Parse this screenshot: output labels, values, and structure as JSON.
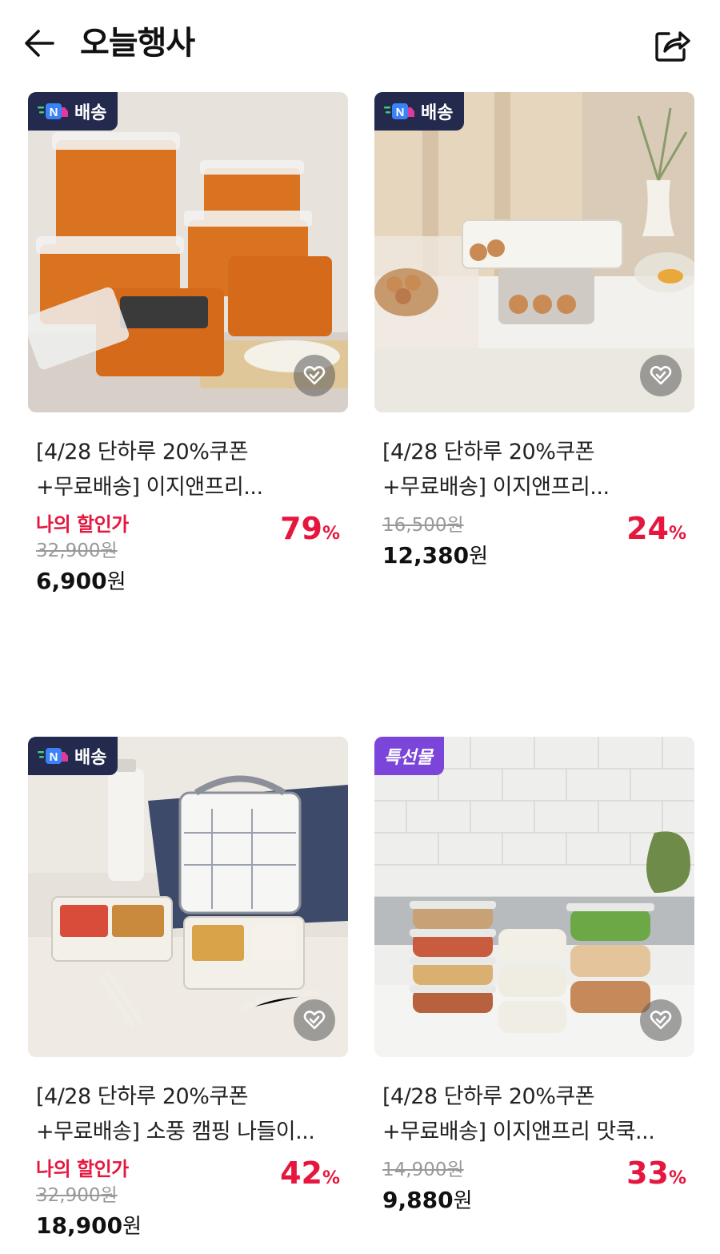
{
  "header": {
    "title": "오늘행사"
  },
  "products": [
    {
      "badge": "배송",
      "badge_type": "n-delivery",
      "title_line1": "[4/28 단하루 20%쿠폰",
      "title_line2": "+무료배송] 이지앤프리...",
      "my_price_label": "나의 할인가",
      "original_price": "32,900원",
      "final_price": "6,900",
      "currency": "원",
      "discount_rate": "79",
      "percent": "%"
    },
    {
      "badge": "배송",
      "badge_type": "n-delivery",
      "title_line1": "[4/28 단하루 20%쿠폰",
      "title_line2": "+무료배송] 이지앤프리...",
      "my_price_label": "",
      "original_price": "16,500원",
      "final_price": "12,380",
      "currency": "원",
      "discount_rate": "24",
      "percent": "%"
    },
    {
      "badge": "배송",
      "badge_type": "n-delivery",
      "title_line1": "[4/28 단하루 20%쿠폰",
      "title_line2": "+무료배송] 소풍 캠핑 나들이...",
      "my_price_label": "나의 할인가",
      "original_price": "32,900원",
      "final_price": "18,900",
      "currency": "원",
      "discount_rate": "42",
      "percent": "%"
    },
    {
      "badge": "특선물",
      "badge_type": "gift",
      "title_line1": "[4/28 단하루 20%쿠폰",
      "title_line2": "+무료배송] 이지앤프리 맛쿡...",
      "my_price_label": "",
      "original_price": "14,900원",
      "final_price": "9,880",
      "currency": "원",
      "discount_rate": "33",
      "percent": "%"
    }
  ],
  "icons": {
    "back": "arrow-left-icon",
    "share": "share-icon",
    "wishlist": "heart-check-icon",
    "delivery": "n-delivery-truck-icon"
  },
  "colors": {
    "accent_red": "#e5173f",
    "badge_navy": "#232a4e",
    "badge_purple": "#7c45d9"
  }
}
